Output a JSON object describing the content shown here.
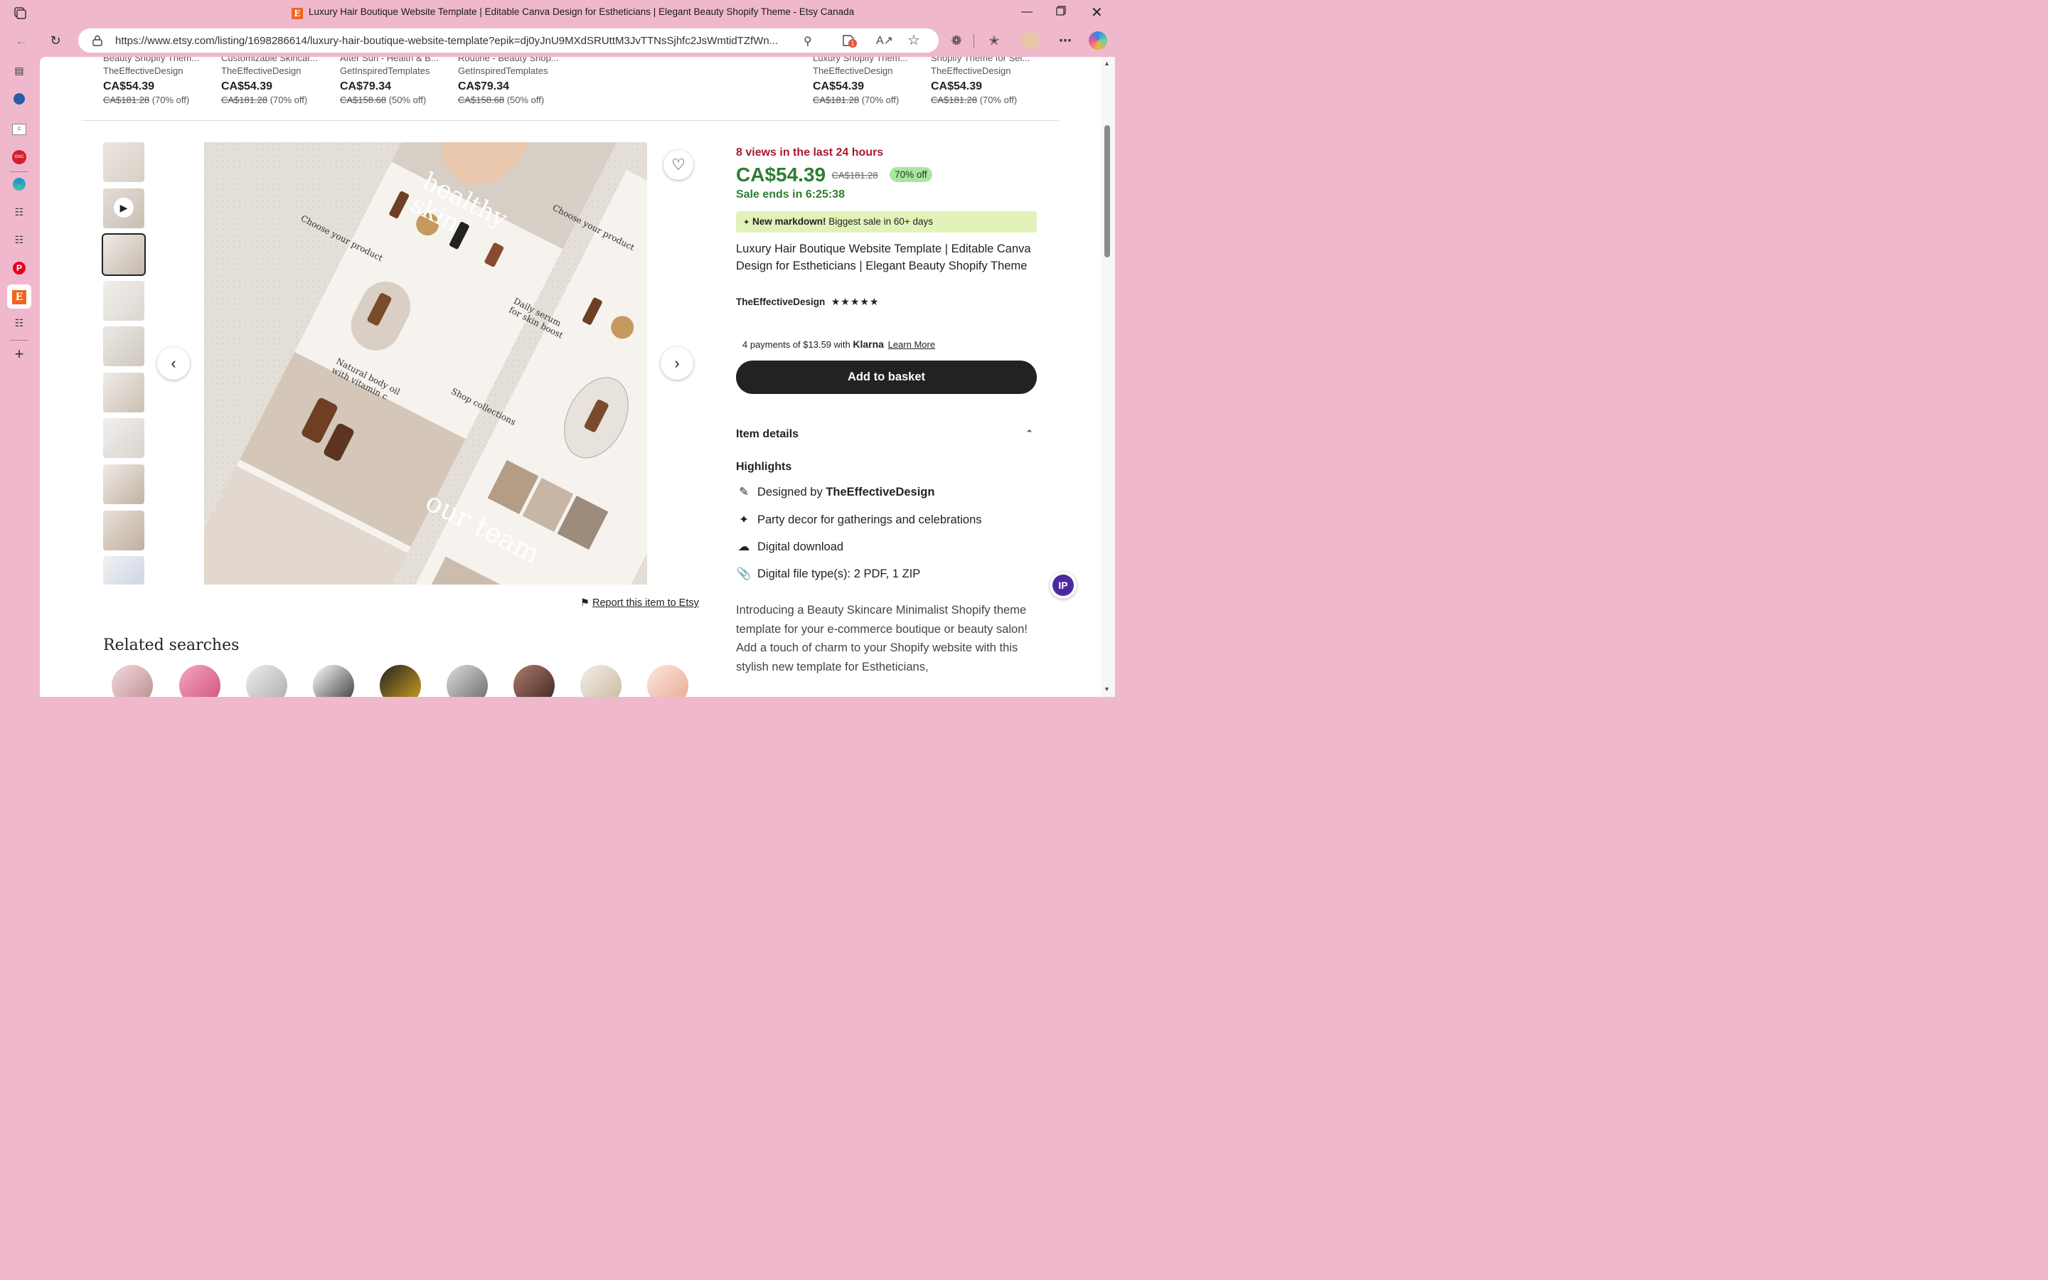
{
  "window": {
    "tab_title": "Luxury Hair Boutique Website Template | Editable Canva Design for Estheticians | Elegant Beauty Shopify Theme - Etsy Canada",
    "favicon_letter": "E"
  },
  "browser": {
    "url": "https://www.etsy.com/listing/1698286614/luxury-hair-boutique-website-template?epik=dj0yJnU9MXdSRUttM3JvTTNsSjhfc2JsWmtidTZfWn...",
    "reading_badge": "1"
  },
  "carousel_top": [
    {
      "title": "Beauty Shopify Them...",
      "shop": "TheEffectiveDesign",
      "price": "CA$54.39",
      "orig": "CA$181.28",
      "discount": "(70% off)"
    },
    {
      "title": "Customizable Skincar...",
      "shop": "TheEffectiveDesign",
      "price": "CA$54.39",
      "orig": "CA$181.28",
      "discount": "(70% off)"
    },
    {
      "title": "After Sun - Health & B...",
      "shop": "GetInspiredTemplates",
      "price": "CA$79.34",
      "orig": "CA$158.68",
      "discount": "(50% off)"
    },
    {
      "title": "Routine - Beauty Shop...",
      "shop": "GetInspiredTemplates",
      "price": "CA$79.34",
      "orig": "CA$158.68",
      "discount": "(50% off)"
    },
    {
      "title": "Luxury Shopify Them...",
      "shop": "TheEffectiveDesign",
      "price": "CA$54.39",
      "orig": "CA$181.28",
      "discount": "(70% off)"
    },
    {
      "title": "Shopify Theme for Sel...",
      "shop": "TheEffectiveDesign",
      "price": "CA$54.39",
      "orig": "CA$181.28",
      "discount": "(70% off)"
    }
  ],
  "gallery": {
    "main_text_1": "healthy skin",
    "main_text_2": "Choose your product",
    "main_text_3": "Natural body oil with vitamin c",
    "main_text_4": "Daily serum for skin boost",
    "main_text_5": "Shop collections",
    "main_text_6": "our team",
    "report_link": "Report this item to Etsy"
  },
  "listing": {
    "views": "8 views in the last 24 hours",
    "price": "CA$54.39",
    "orig_price": "CA$181.28",
    "discount": "70% off",
    "sale_ends": "Sale ends in 6:25:38",
    "markdown_bold": "New markdown!",
    "markdown_text": "Biggest sale in 60+ days",
    "title": "Luxury Hair Boutique Website Template | Editable Canva Design for Estheticians | Elegant Beauty Shopify Theme",
    "shop": "TheEffectiveDesign",
    "stars": "★★★★★",
    "klarna_text": "4 payments of $13.59 with",
    "klarna_brand": "Klarna",
    "klarna_link": "Learn More",
    "add_to_basket": "Add to basket",
    "item_details": "Item details",
    "highlights": "Highlights",
    "hl_designed": "Designed by",
    "hl_designer": "TheEffectiveDesign",
    "hl_party": "Party decor for gatherings and celebrations",
    "hl_download": "Digital download",
    "hl_filetype": "Digital file type(s): 2 PDF, 1 ZIP",
    "description": "Introducing a Beauty Skincare Minimalist Shopify theme template for your e-commerce boutique or beauty salon! Add a touch of charm to your Shopify website with this stylish new template for Estheticians,"
  },
  "related": {
    "heading": "Related searches"
  },
  "colors": {
    "accent_green": "#2f7d32",
    "views_red": "#a61a2e",
    "badge_green": "#a8e6a1",
    "markdown_bg": "#e3f2b8"
  }
}
